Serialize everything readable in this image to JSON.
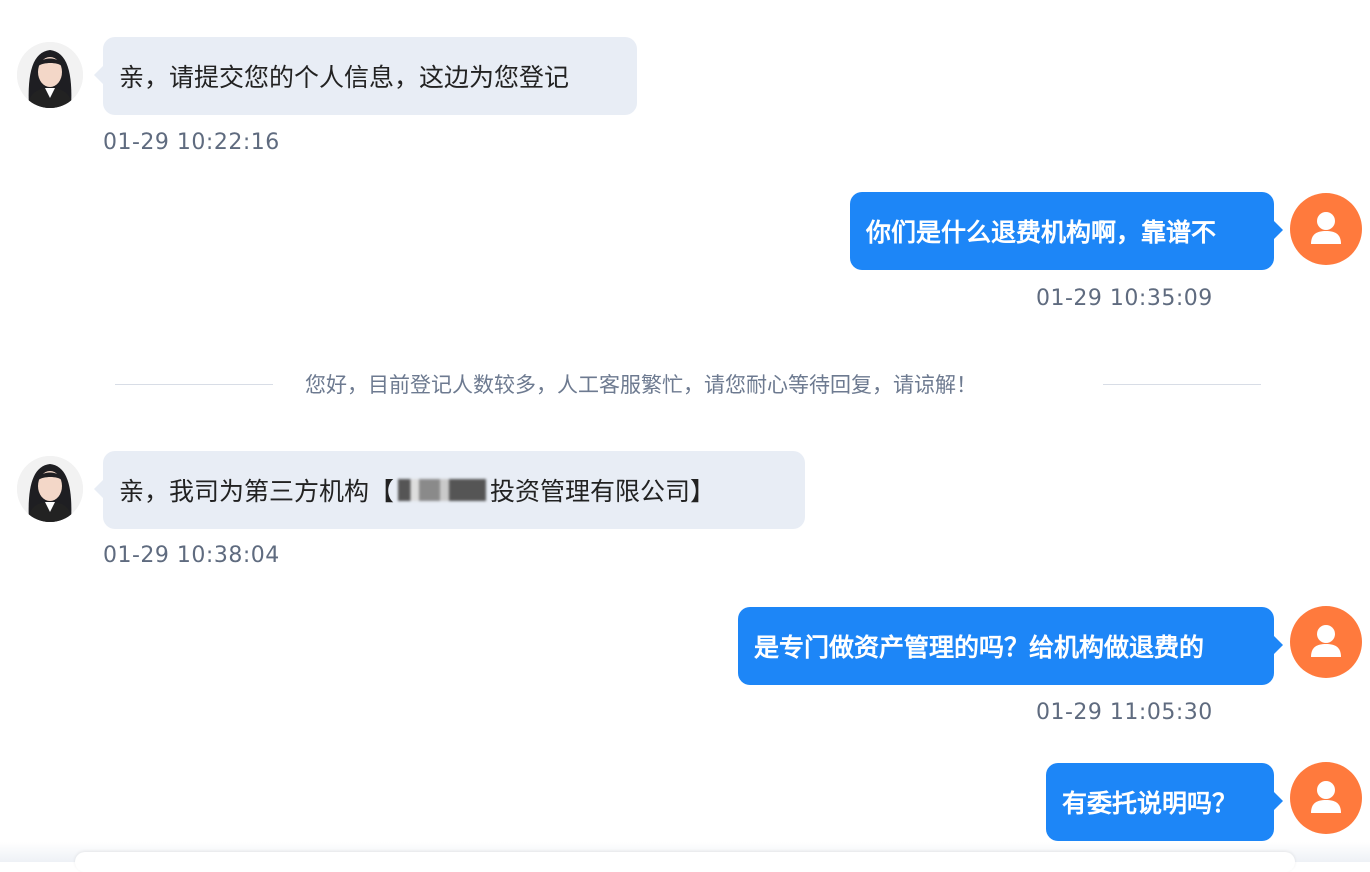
{
  "messages": [
    {
      "sender": "agent",
      "text": "亲，请提交您的个人信息，这边为您登记",
      "time": "01-29 10:22:16"
    },
    {
      "sender": "user",
      "text": "你们是什么退费机构啊，靠谱不",
      "time": "01-29 10:35:09"
    },
    {
      "sender": "agent",
      "text_before": "亲，我司为第三方机构【",
      "text_after": "投资管理有限公司】",
      "time": "01-29 10:38:04"
    },
    {
      "sender": "user",
      "text": "是专门做资产管理的吗？给机构做退费的",
      "time": "01-29 11:05:30"
    },
    {
      "sender": "user",
      "text": "有委托说明吗？"
    }
  ],
  "system_notice": "您好，目前登记人数较多，人工客服繁忙，请您耐心等待回复，请谅解！",
  "colors": {
    "agent_bubble": "#e8edf5",
    "user_bubble": "#1d86f7",
    "user_avatar": "#ff7a3d",
    "timestamp_text": "#5f6b7f"
  },
  "icons": {
    "user_avatar": "person-icon",
    "agent_avatar": "agent-photo-avatar"
  }
}
